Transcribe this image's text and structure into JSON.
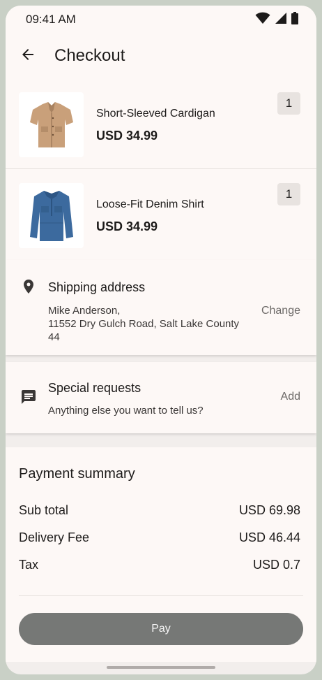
{
  "status_bar": {
    "time": "09:41 AM",
    "icons": [
      "wifi-icon",
      "cellular-signal-icon",
      "battery-icon"
    ]
  },
  "app_bar": {
    "back_icon": "arrow-back-icon",
    "title": "Checkout"
  },
  "cart": {
    "items": [
      {
        "name": "Short-Sleeved Cardigan",
        "price": "USD 34.99",
        "quantity": "1",
        "image": "cardigan-image"
      },
      {
        "name": "Loose-Fit Denim Shirt",
        "price": "USD 34.99",
        "quantity": "1",
        "image": "denim-shirt-image"
      }
    ]
  },
  "shipping": {
    "icon": "location-pin-icon",
    "title": "Shipping address",
    "name": "Mike Anderson,",
    "address_line": "11552 Dry Gulch Road, Salt Lake County",
    "address_line2": "44",
    "action": "Change"
  },
  "special_requests": {
    "icon": "message-icon",
    "title": "Special requests",
    "subtitle": "Anything else you want to tell us?",
    "action": "Add"
  },
  "payment_summary": {
    "title": "Payment summary",
    "rows": [
      {
        "label": "Sub total",
        "value": "USD 69.98"
      },
      {
        "label": "Delivery Fee",
        "value": "USD 46.44"
      },
      {
        "label": "Tax",
        "value": "USD 0.7"
      }
    ],
    "pay_label": "Pay"
  },
  "colors": {
    "background": "#fdf8f6",
    "pay_button": "#767876",
    "frame": "#c9d0c6"
  }
}
